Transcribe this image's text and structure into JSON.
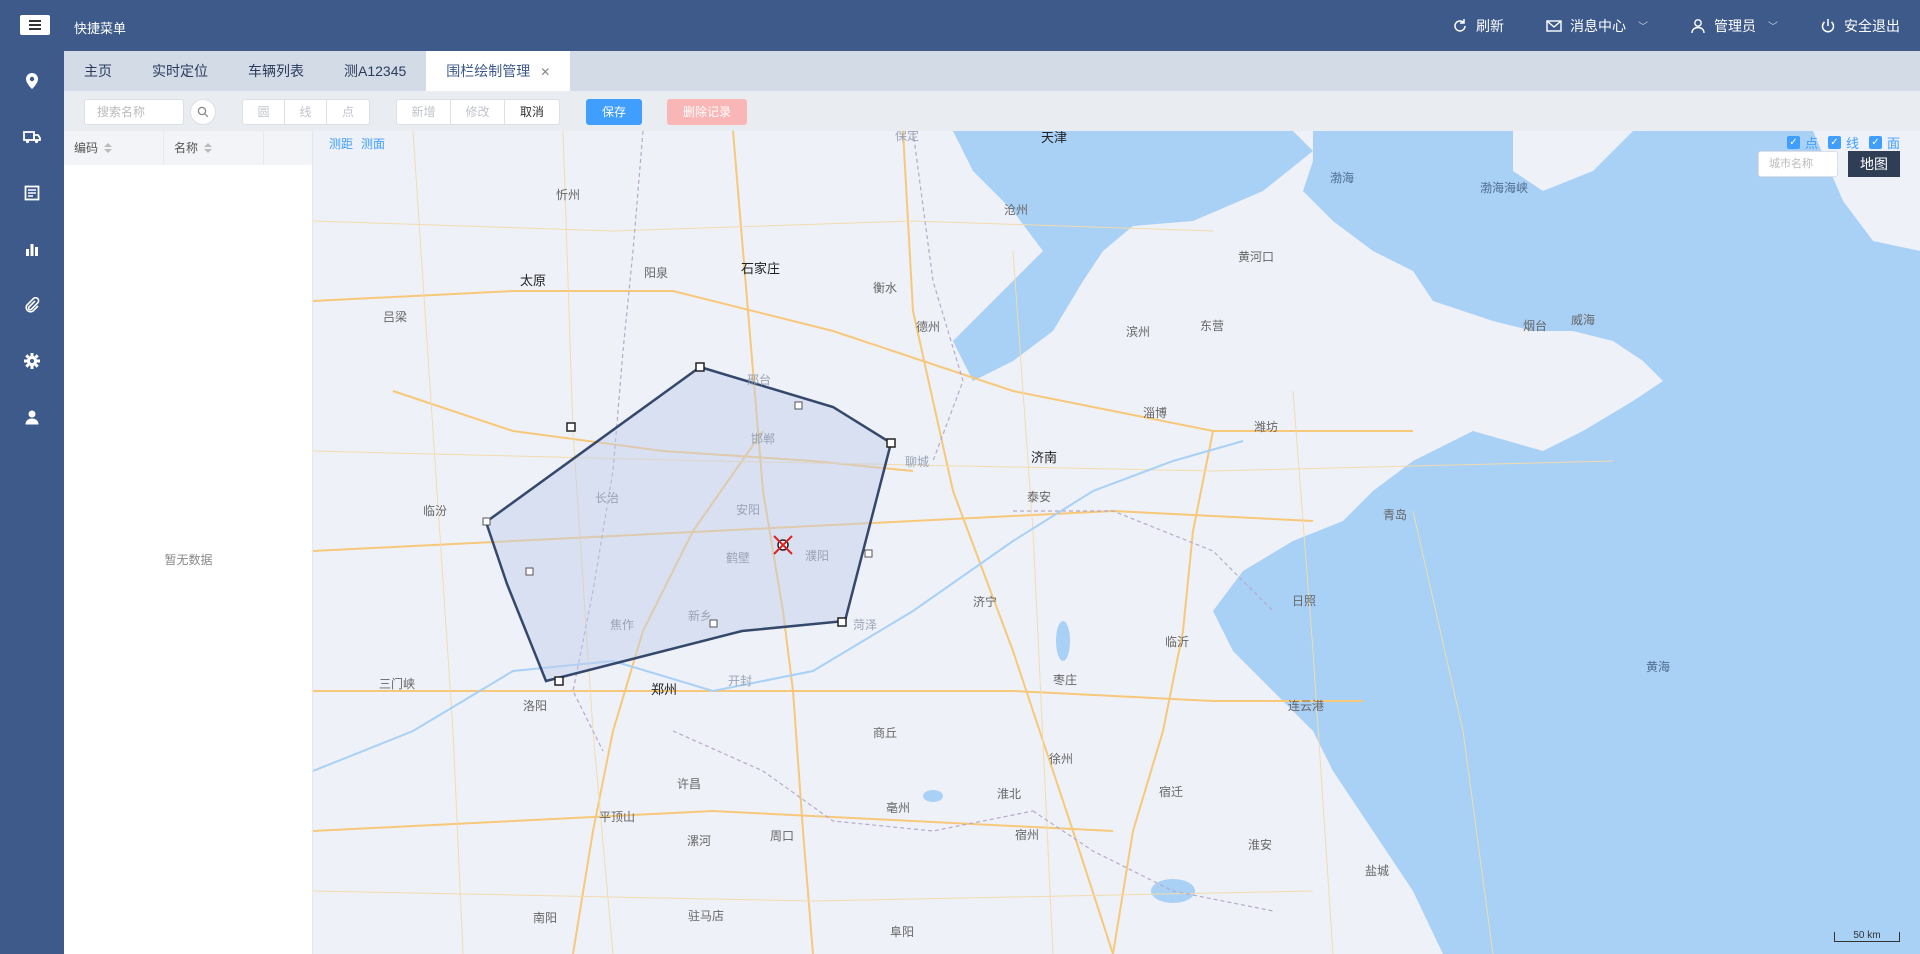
{
  "topbar": {
    "quick_menu": "快捷菜单",
    "refresh": "刷新",
    "messages": "消息中心",
    "user": "管理员",
    "logout": "安全退出"
  },
  "sidebar": {
    "icons": [
      "location-icon",
      "truck-icon",
      "report-icon",
      "chart-icon",
      "attachment-icon",
      "gear-icon",
      "user-icon"
    ]
  },
  "tabs": [
    {
      "label": "主页"
    },
    {
      "label": "实时定位"
    },
    {
      "label": "车辆列表"
    },
    {
      "label": "测A12345"
    },
    {
      "label": "围栏绘制管理",
      "active": true,
      "closable": true
    }
  ],
  "toolbar": {
    "search_placeholder": "搜索名称",
    "shape_circle": "圆",
    "shape_line": "线",
    "shape_point": "点",
    "add": "新增",
    "edit": "修改",
    "cancel": "取消",
    "save": "保存",
    "delete_record": "删除记录"
  },
  "panel": {
    "col_code": "编码",
    "col_name": "名称",
    "empty": "暂无数据"
  },
  "map": {
    "tool_distance": "测距",
    "tool_area": "测面",
    "layer_point": "点",
    "layer_line": "线",
    "layer_area": "面",
    "city_placeholder": "城市名称",
    "map_button": "地图",
    "scale": "50 km",
    "accent": "#409eff",
    "sea_color": "#a9d0f5",
    "fence_color": "#34486b",
    "cities": {
      "tianjin": "天津",
      "bohai": "渤海",
      "bohai_strait": "渤海海峡",
      "xinzhou": "忻州",
      "cangzhou": "沧州",
      "shijiazhuang": "石家庄",
      "yangquan": "阳泉",
      "taiyuan": "太原",
      "huanghekou": "黄河口",
      "hengshui": "衡水",
      "lvliang": "吕梁",
      "dezhou": "德州",
      "binzhou": "滨州",
      "dongying": "东营",
      "yantai": "烟台",
      "weihai": "威海",
      "xingtai": "邢台",
      "handan": "邯郸",
      "liaocheng": "聊城",
      "zibo": "淄博",
      "jinan": "济南",
      "weifang": "潍坊",
      "changzhi": "长治",
      "taian": "泰安",
      "linfen": "临汾",
      "anyang": "安阳",
      "qingdao": "青岛",
      "hebi": "鹤壁",
      "puyang": "濮阳",
      "jining": "济宁",
      "rizhao": "日照",
      "xinxiang": "新乡",
      "jiaozuo": "焦作",
      "heze": "菏泽",
      "linyi": "临沂",
      "sanmenxia": "三门峡",
      "zhengzhou": "郑州",
      "kaifeng": "开封",
      "zaozhuang": "枣庄",
      "huanghai": "黄海",
      "luoyang": "洛阳",
      "lianyungang": "连云港",
      "shangqiu": "商丘",
      "xuzhou": "徐州",
      "xuchang": "许昌",
      "pingdingshan": "平顶山",
      "huaibei": "淮北",
      "suqian": "宿迁",
      "bozhou": "亳州",
      "luohe": "漯河",
      "zhoukou": "周口",
      "suzhou": "宿州",
      "huaian": "淮安",
      "yancheng": "盐城",
      "nanyang": "南阳",
      "zhumadian": "驻马店",
      "fuyang": "阜阳",
      "baoding": "保定"
    }
  }
}
